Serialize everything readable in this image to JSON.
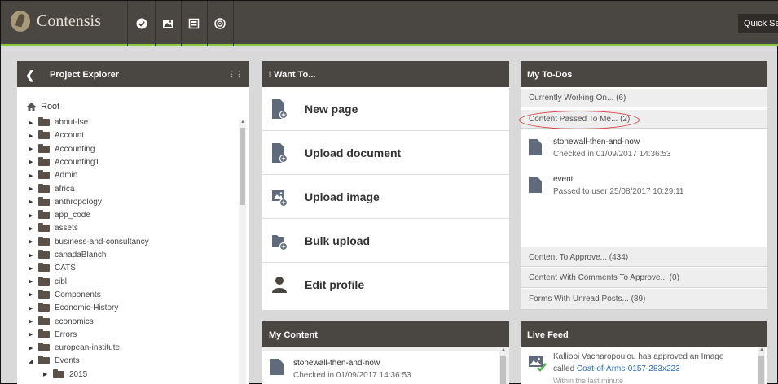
{
  "topbar": {
    "app_name": "Contensis",
    "quick_search": "Quick Sea",
    "icons": [
      "check-icon",
      "image-icon",
      "page-icon",
      "settings-icon"
    ]
  },
  "project_explorer": {
    "title": "Project Explorer",
    "root": "Root",
    "items": [
      {
        "label": "about-lse",
        "expanded": false,
        "level": 1
      },
      {
        "label": "Account",
        "expanded": false,
        "level": 1
      },
      {
        "label": "Accounting",
        "expanded": false,
        "level": 1
      },
      {
        "label": "Accounting1",
        "expanded": false,
        "level": 1
      },
      {
        "label": "Admin",
        "expanded": false,
        "level": 1
      },
      {
        "label": "africa",
        "expanded": false,
        "level": 1
      },
      {
        "label": "anthropology",
        "expanded": false,
        "level": 1
      },
      {
        "label": "app_code",
        "expanded": false,
        "level": 1
      },
      {
        "label": "assets",
        "expanded": false,
        "level": 1
      },
      {
        "label": "business-and-consultancy",
        "expanded": false,
        "level": 1
      },
      {
        "label": "canadaBlanch",
        "expanded": false,
        "level": 1
      },
      {
        "label": "CATS",
        "expanded": false,
        "level": 1
      },
      {
        "label": "cibl",
        "expanded": false,
        "level": 1
      },
      {
        "label": "Components",
        "expanded": false,
        "level": 1
      },
      {
        "label": "Economic-History",
        "expanded": false,
        "level": 1
      },
      {
        "label": "economics",
        "expanded": false,
        "level": 1
      },
      {
        "label": "Errors",
        "expanded": false,
        "level": 1
      },
      {
        "label": "european-institute",
        "expanded": false,
        "level": 1
      },
      {
        "label": "Events",
        "expanded": true,
        "level": 1
      },
      {
        "label": "2015",
        "expanded": false,
        "level": 2
      }
    ]
  },
  "i_want_to": {
    "title": "I Want To...",
    "actions": [
      {
        "label": "New page",
        "icon": "new-page-icon"
      },
      {
        "label": "Upload document",
        "icon": "upload-document-icon"
      },
      {
        "label": "Upload image",
        "icon": "upload-image-icon"
      },
      {
        "label": "Bulk upload",
        "icon": "bulk-upload-icon"
      },
      {
        "label": "Edit profile",
        "icon": "user-icon"
      }
    ]
  },
  "todos": {
    "title": "My To-Dos",
    "working_on": "Currently Working On... (6)",
    "passed_to_me": "Content Passed To Me... (2)",
    "docs": [
      {
        "title": "stonewall-then-and-now",
        "detail": "Checked in 01/09/2017 14:36:53"
      },
      {
        "title": "event",
        "detail": "Passed to user 25/08/2017 10:29:11"
      }
    ],
    "to_approve": "Content To Approve... (434)",
    "comments_to_approve": "Content With Comments To Approve... (0)",
    "forms_unread": "Forms With Unread Posts... (89)"
  },
  "my_content": {
    "title": "My Content",
    "item_title": "stonewall-then-and-now",
    "item_detail": "Checked in 01/09/2017 14:36:53"
  },
  "live_feed": {
    "title": "Live Feed",
    "line1": "Kalliopi Vacharopoulou has approved an Image",
    "line2_prefix": "called ",
    "line2_link": "Coat-of-Arms-0157-283x223",
    "line3": "Within the last minute"
  },
  "colors": {
    "header_bg": "#4a4641",
    "accent_green": "#8dc63f",
    "annotation_red": "#d43a3a"
  }
}
